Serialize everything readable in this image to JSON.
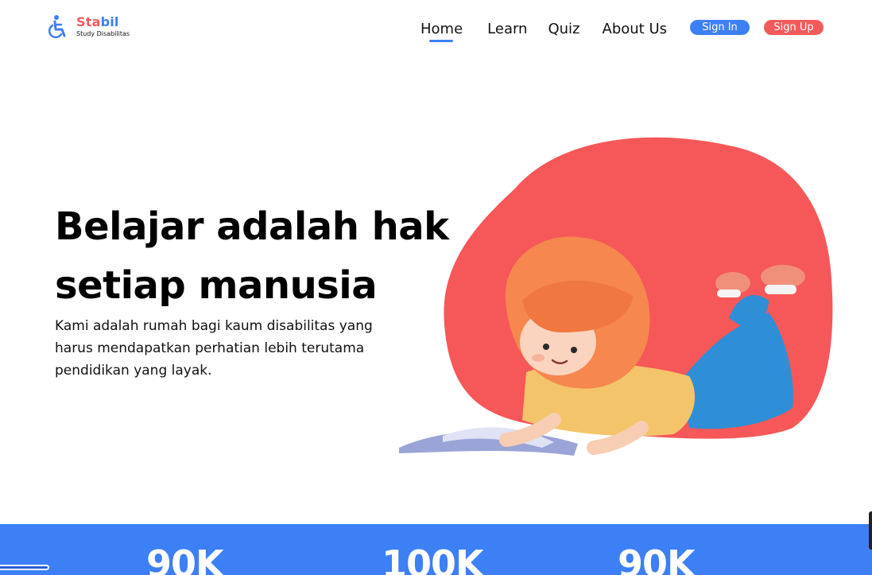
{
  "brand": {
    "name_part1": "Sta",
    "name_part2": "bil",
    "tagline": "Study Disabilitas",
    "icon": "wheelchair-icon",
    "colors": {
      "red": "#f25a5a",
      "blue": "#3d7ff5"
    }
  },
  "nav": {
    "items": [
      {
        "label": "Home",
        "active": true
      },
      {
        "label": "Learn",
        "active": false
      },
      {
        "label": "Quiz",
        "active": false
      },
      {
        "label": "About Us",
        "active": false
      }
    ],
    "sign_in": "Sign In",
    "sign_up": "Sign Up"
  },
  "hero": {
    "title_line1": "Belajar adalah hak",
    "title_line2": "setiap manusia",
    "description": "Kami  adalah rumah bagi  kaum disabilitas yang harus mendapatkan perhatian lebih terutama pendidikan yang layak.",
    "illustration": "girl-reading-book-illustration"
  },
  "stats": {
    "values": [
      "90K",
      "100K",
      "90K"
    ]
  }
}
